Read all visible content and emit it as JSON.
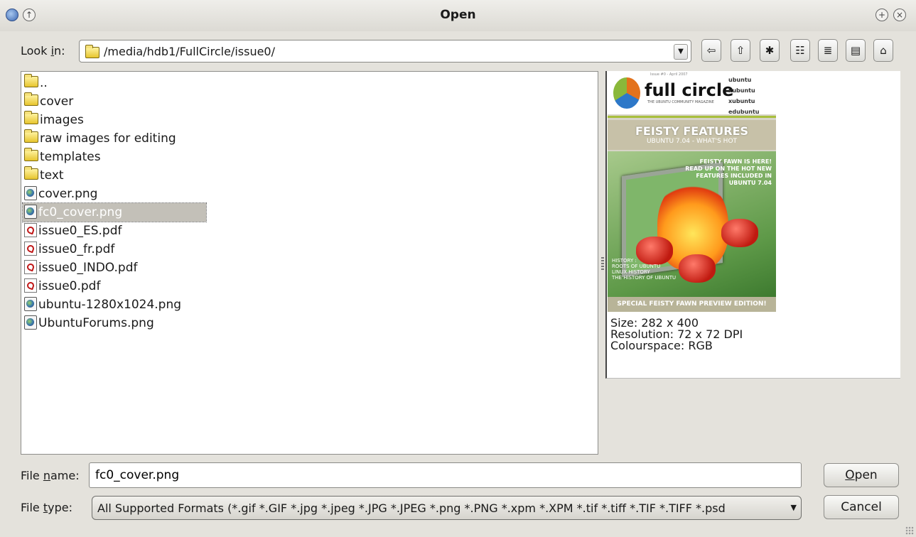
{
  "window": {
    "title": "Open"
  },
  "look_in": {
    "label_prefix": "Look ",
    "label_mnemonic": "i",
    "label_suffix": "n:",
    "path": "/media/hdb1/FullCircle/issue0/"
  },
  "toolbar": {
    "back": "back-icon",
    "up": "folder-up-icon",
    "new_folder": "new-folder-icon",
    "list_view": "list-view-icon",
    "detail_view": "detail-view-icon",
    "preview_view": "preview-view-icon",
    "home": "home-icon"
  },
  "files": [
    {
      "name": "..",
      "type": "folder"
    },
    {
      "name": "cover",
      "type": "folder"
    },
    {
      "name": "images",
      "type": "folder"
    },
    {
      "name": "raw images for editing",
      "type": "folder"
    },
    {
      "name": "templates",
      "type": "folder"
    },
    {
      "name": "text",
      "type": "folder"
    },
    {
      "name": "cover.png",
      "type": "png"
    },
    {
      "name": "fc0_cover.png",
      "type": "png",
      "selected": true
    },
    {
      "name": "issue0_ES.pdf",
      "type": "pdf"
    },
    {
      "name": "issue0_fr.pdf",
      "type": "pdf"
    },
    {
      "name": "issue0_INDO.pdf",
      "type": "pdf"
    },
    {
      "name": "issue0.pdf",
      "type": "pdf"
    },
    {
      "name": "ubuntu-1280x1024.png",
      "type": "png"
    },
    {
      "name": "UbuntuForums.png",
      "type": "png"
    }
  ],
  "preview": {
    "cover": {
      "issue_line": "Issue #0 - April 2007",
      "logo": "full circle",
      "tagline": "THE UBUNTU COMMUNITY MAGAZINE",
      "distros": [
        "ubuntu",
        "kubuntu",
        "xubuntu",
        "edubuntu"
      ],
      "headline": "FEISTY FEATURES",
      "subheadline": "UBUNTU 7.04 - WHAT'S HOT",
      "right_lines": [
        "FEISTY FAWN IS HERE!",
        "READ UP ON THE HOT NEW",
        "FEATURES INCLUDED IN",
        "UBUNTU 7.04"
      ],
      "history_lines": [
        "HISTORY :",
        "ROOTS OF UBUNTU",
        "LINUX HISTORY",
        "THE HISTORY OF UBUNTU"
      ],
      "footer": "SPECIAL FEISTY FAWN PREVIEW EDITION!"
    },
    "size": "Size: 282 x 400",
    "resolution": "Resolution: 72 x 72 DPI",
    "colourspace": "Colourspace: RGB"
  },
  "file_name": {
    "label_prefix": "File ",
    "label_mnemonic": "n",
    "label_suffix": "ame:",
    "value": "fc0_cover.png"
  },
  "file_type": {
    "label_prefix": "File ",
    "label_mnemonic": "t",
    "label_suffix": "ype:",
    "value": "All Supported Formats (*.gif *.GIF *.jpg *.jpeg *.JPG *.JPEG *.png *.PNG *.xpm *.XPM *.tif *.tiff *.TIF *.TIFF *.psd"
  },
  "buttons": {
    "open_mnemonic": "O",
    "open_rest": "pen",
    "cancel": "Cancel"
  }
}
